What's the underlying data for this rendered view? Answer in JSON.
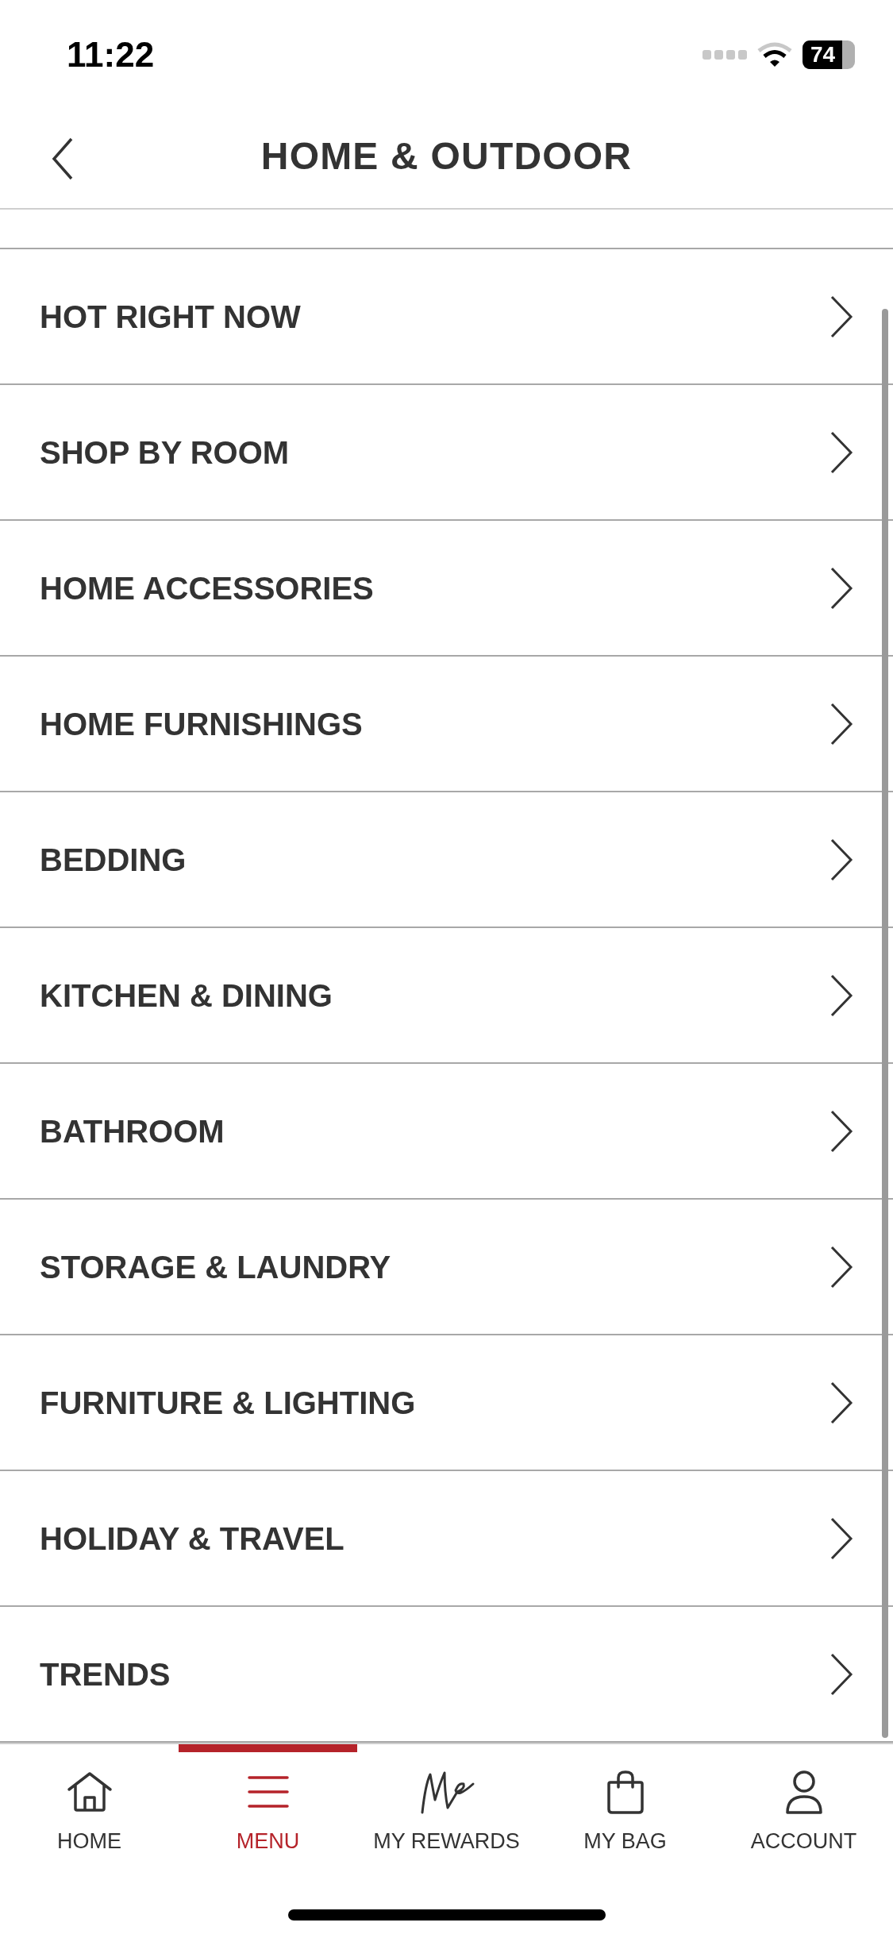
{
  "status_bar": {
    "time": "11:22",
    "battery": "74"
  },
  "header": {
    "title": "HOME & OUTDOOR"
  },
  "menu_items": [
    "HOT RIGHT NOW",
    "SHOP BY ROOM",
    "HOME ACCESSORIES",
    "HOME FURNISHINGS",
    "BEDDING",
    "KITCHEN & DINING",
    "BATHROOM",
    "STORAGE & LAUNDRY",
    "FURNITURE & LIGHTING",
    "HOLIDAY & TRAVEL",
    "TRENDS"
  ],
  "tab_bar": [
    {
      "kind": "home",
      "label": "HOME",
      "selected": false
    },
    {
      "kind": "menu",
      "label": "MENU",
      "selected": true
    },
    {
      "kind": "rewards",
      "label": "MY REWARDS",
      "selected": false
    },
    {
      "kind": "bag",
      "label": "MY BAG",
      "selected": false
    },
    {
      "kind": "account",
      "label": "ACCOUNT",
      "selected": false
    }
  ]
}
